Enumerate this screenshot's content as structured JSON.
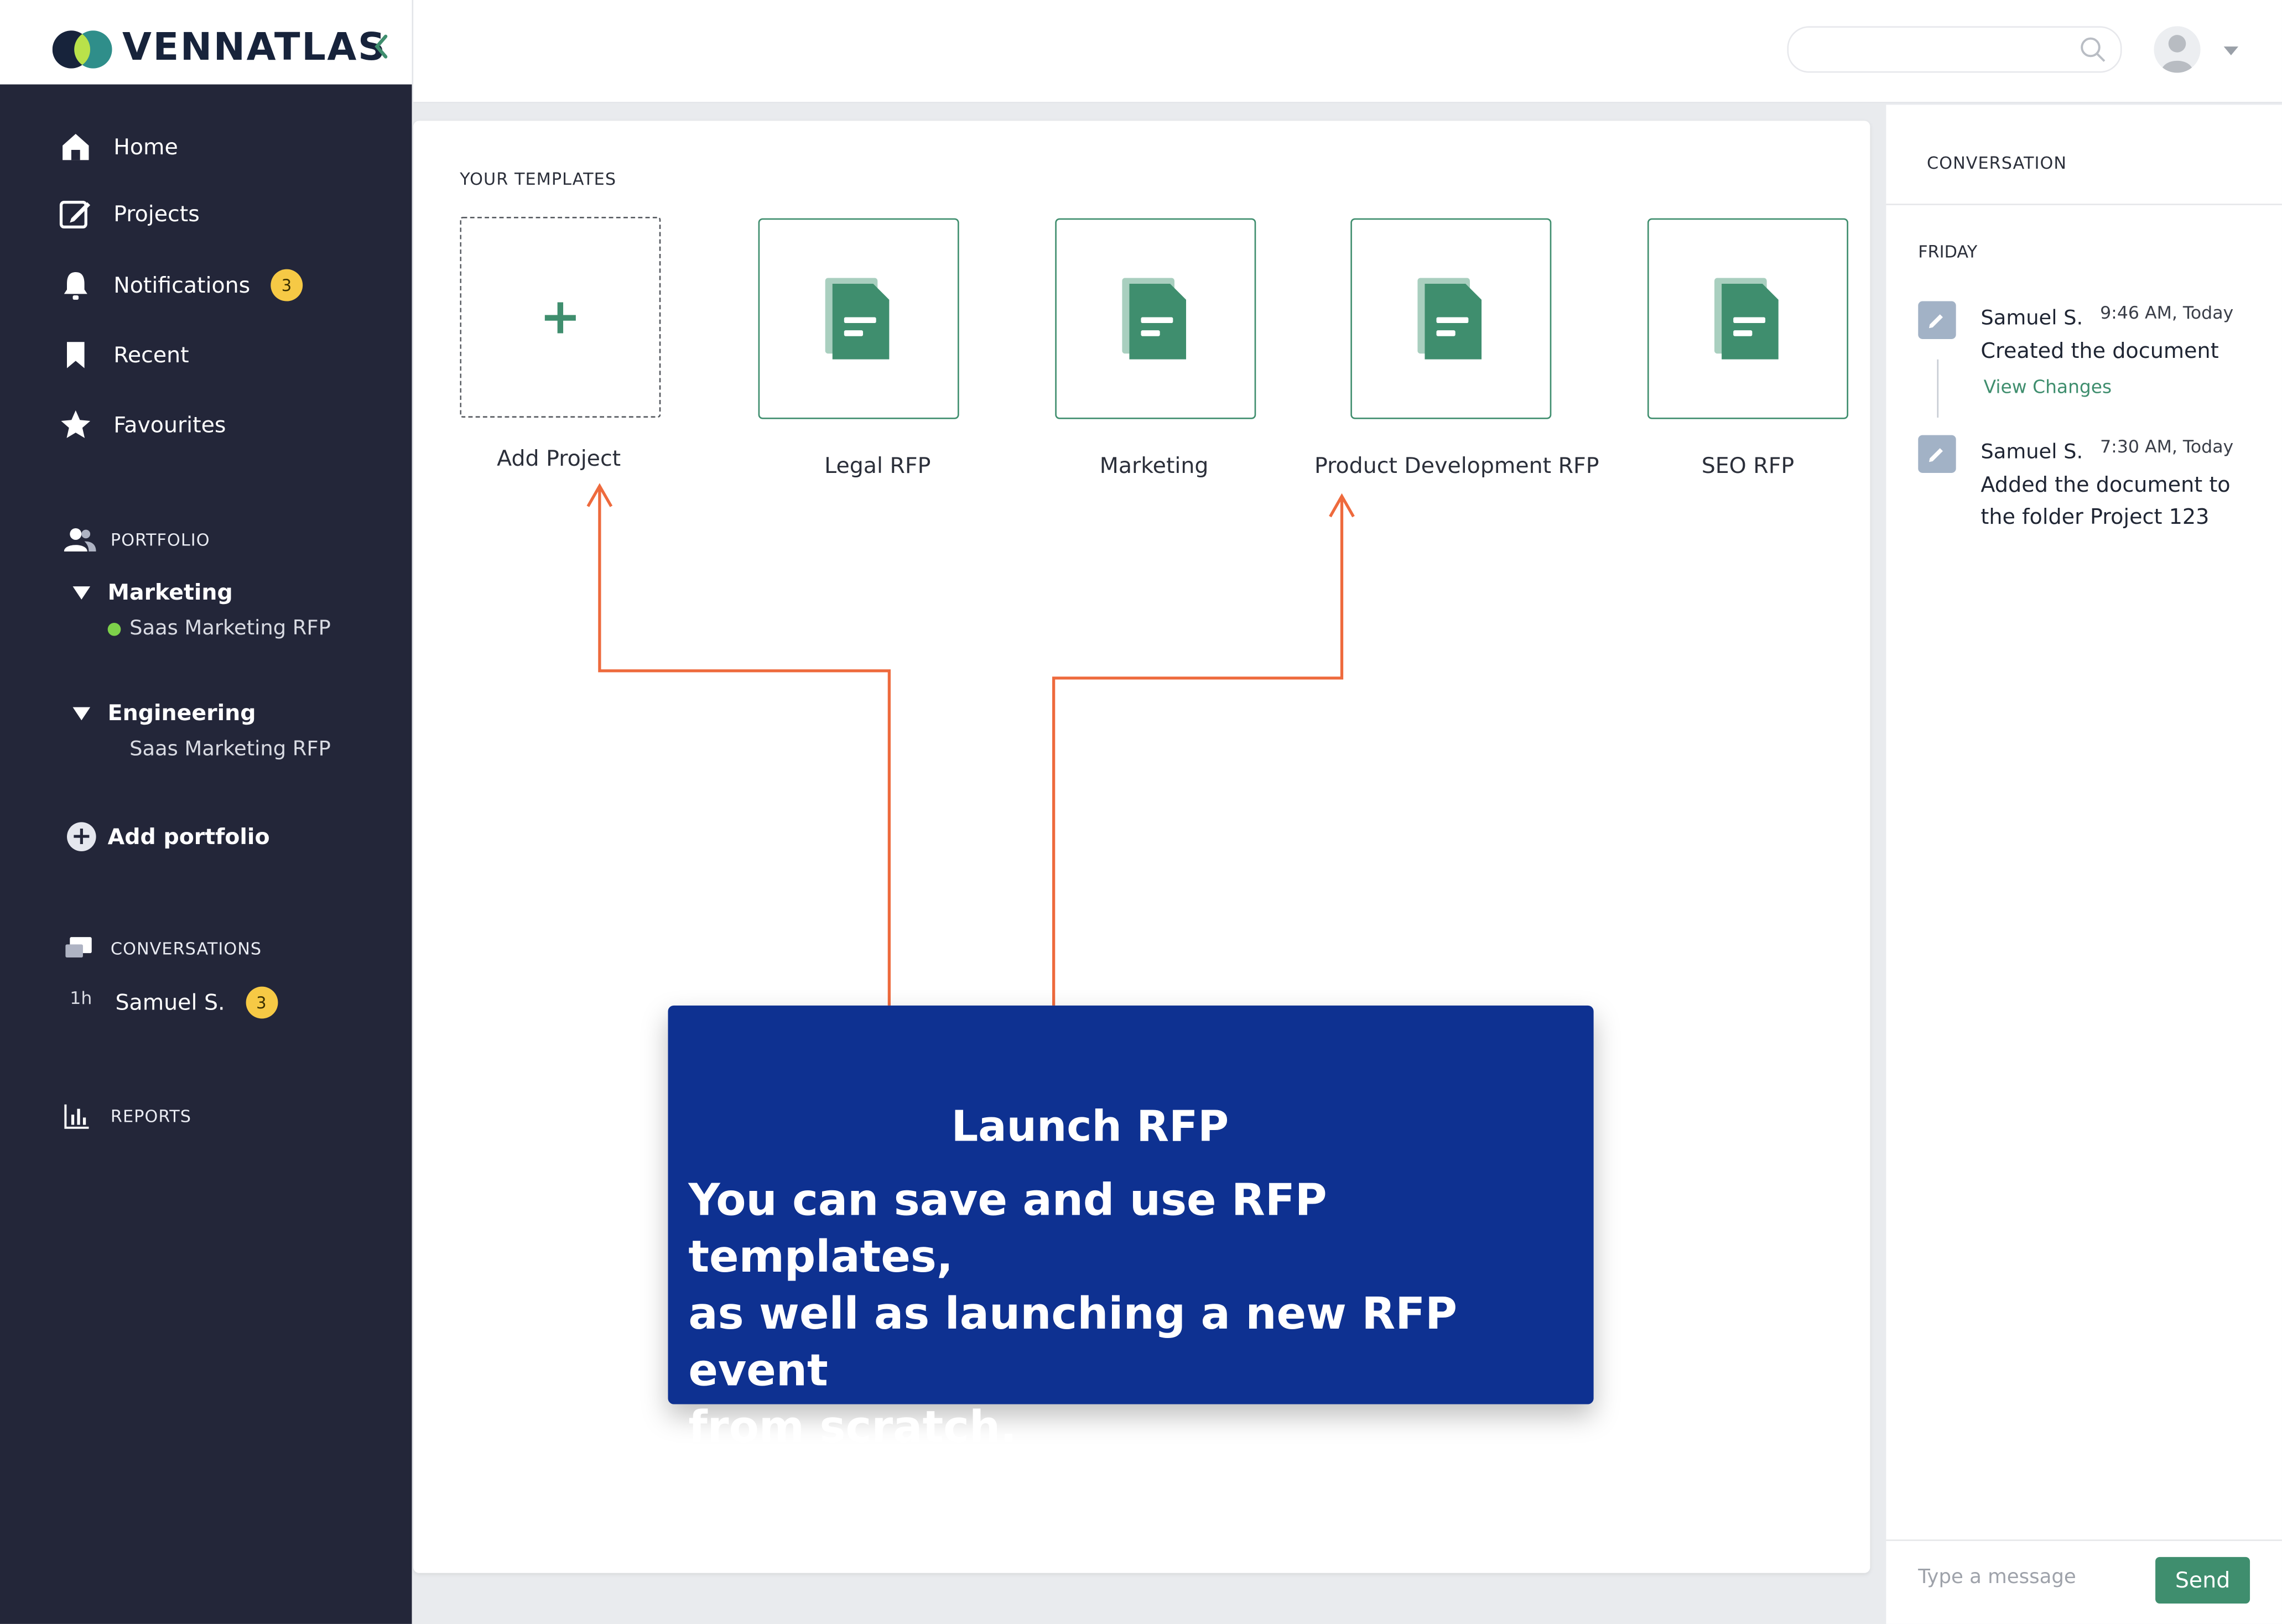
{
  "brand": {
    "name": "VENNATLAS"
  },
  "nav": {
    "home": "Home",
    "projects": "Projects",
    "notifications": "Notifications",
    "notifications_badge": "3",
    "recent": "Recent",
    "favourites": "Favourites"
  },
  "portfolio": {
    "header": "PORTFOLIO",
    "groups": [
      {
        "name": "Marketing",
        "items": [
          "Saas Marketing RFP"
        ]
      },
      {
        "name": "Engineering",
        "items": [
          "Saas Marketing RFP"
        ]
      }
    ],
    "add_label": "Add portfolio"
  },
  "conversations": {
    "header": "CONVERSATIONS",
    "items": [
      {
        "age": "1h",
        "name": "Samuel S.",
        "badge": "3"
      }
    ]
  },
  "reports": {
    "header": "REPORTS"
  },
  "templates": {
    "title": "YOUR TEMPLATES",
    "add_label": "Add Project",
    "items": [
      "Legal RFP",
      "Marketing",
      "Product Development RFP",
      "SEO RFP"
    ]
  },
  "callout": {
    "title": "Launch RFP",
    "body": "You can save and use RFP templates,\n as well as launching a new RFP event\n from scratch."
  },
  "conversation_panel": {
    "header": "CONVERSATION",
    "day": "FRIDAY",
    "messages": [
      {
        "name": "Samuel S.",
        "time": "9:46 AM, Today",
        "text": "Created the document",
        "link": "View Changes"
      },
      {
        "name": "Samuel S.",
        "time": "7:30 AM, Today",
        "text": "Added the document to the folder Project 123"
      }
    ],
    "input_placeholder": "Type a message",
    "send_label": "Send"
  },
  "colors": {
    "sidebar": "#232639",
    "accent_green": "#3f8e6e",
    "callout_blue": "#0e3191",
    "arrow_orange": "#ee6a3d",
    "badge_yellow": "#f6c945"
  }
}
